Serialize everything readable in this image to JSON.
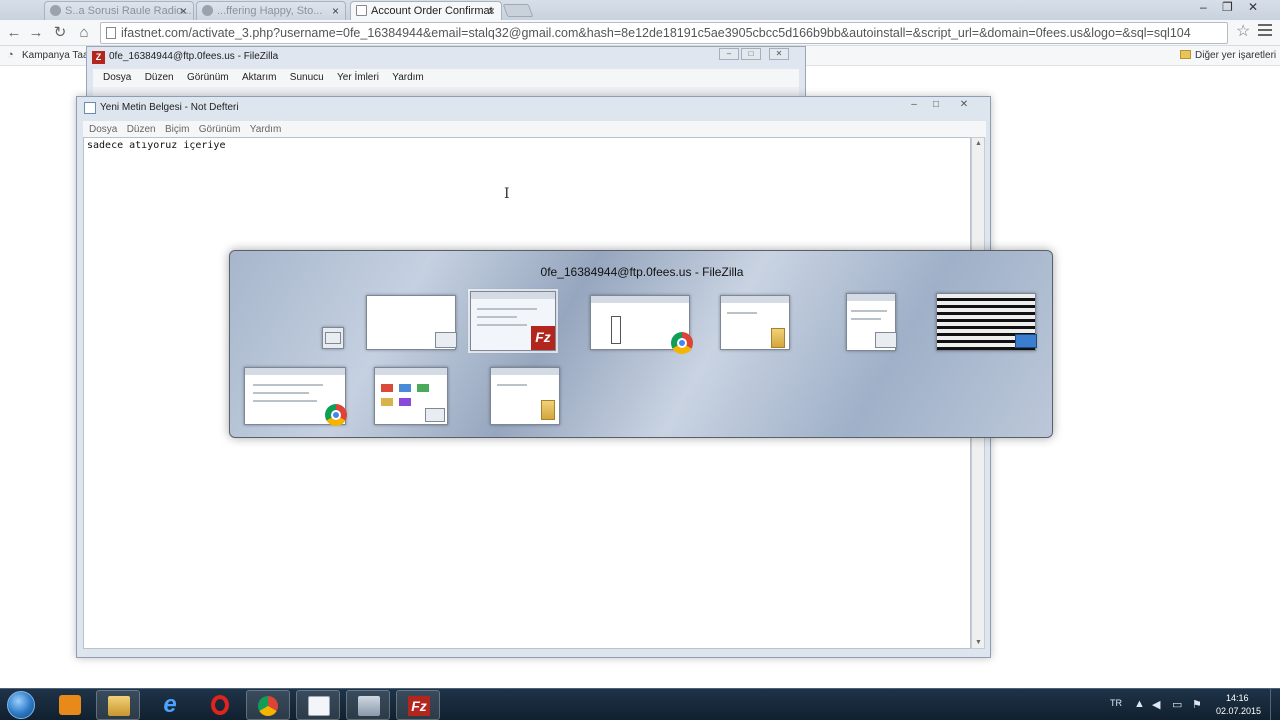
{
  "browser": {
    "tabs": [
      {
        "label": "S..a Sorusi Raule Radio..."
      },
      {
        "label": "...ffering Happy,   Sto..."
      },
      {
        "label": "Account Order Confirmat",
        "active": true
      }
    ],
    "address": "ifastnet.com/activate_3.php?username=0fe_16384944&email=stalq32@gmail.com&hash=8e12de18191c5ae3905cbcc5d166b9bb&autoinstall=&script_url=&domain=0fees.us&logo=&sql=sql104",
    "bookmarks": {
      "first": "Kampanya Taa...",
      "other": "Diğer yer işaretleri"
    },
    "icons": {
      "back": "back-arrow-icon",
      "forward": "forward-arrow-icon",
      "reload": "reload-icon",
      "star": "star-icon",
      "menu": "hamburger-menu-icon"
    }
  },
  "filezilla": {
    "title": "0fe_16384944@ftp.0fees.us - FileZilla",
    "menu": [
      "Dosya",
      "Düzen",
      "Görünüm",
      "Aktarım",
      "Sunucu",
      "Yer İmleri",
      "Yardım"
    ]
  },
  "notepad": {
    "title": "Yeni Metin Belgesi - Not Defteri",
    "menu": [
      "Dosya",
      "Düzen",
      "Biçim",
      "Görünüm",
      "Yardım"
    ],
    "content": "sadece atıyoruz içeriye"
  },
  "switcher": {
    "title": "0fe_16384944@ftp.0fees.us - FileZilla",
    "items": [
      {
        "name": "desktop",
        "badge": "generic"
      },
      {
        "name": "blank-window",
        "badge": "generic"
      },
      {
        "name": "filezilla",
        "badge": "fz",
        "badge_label": "Fz",
        "selected": true
      },
      {
        "name": "chrome",
        "badge": "chrome"
      },
      {
        "name": "explorer",
        "badge": "folder"
      },
      {
        "name": "camstudio",
        "badge": "generic"
      },
      {
        "name": "media",
        "badge": "monitor"
      },
      {
        "name": "chrome-2",
        "badge": "chrome"
      },
      {
        "name": "control-panel",
        "badge": "generic"
      },
      {
        "name": "explorer-2",
        "badge": "folder"
      }
    ]
  },
  "taskbar": {
    "language": "TR",
    "time": "14:16",
    "date": "02.07.2015",
    "apps": [
      "media-player",
      "explorer",
      "internet-explorer",
      "opera",
      "chrome",
      "notepad",
      "network",
      "filezilla"
    ]
  },
  "colors": {
    "filezilla_red": "#b3261e",
    "taskbar": "#1f3348",
    "switcher": "#a7b6cc"
  }
}
